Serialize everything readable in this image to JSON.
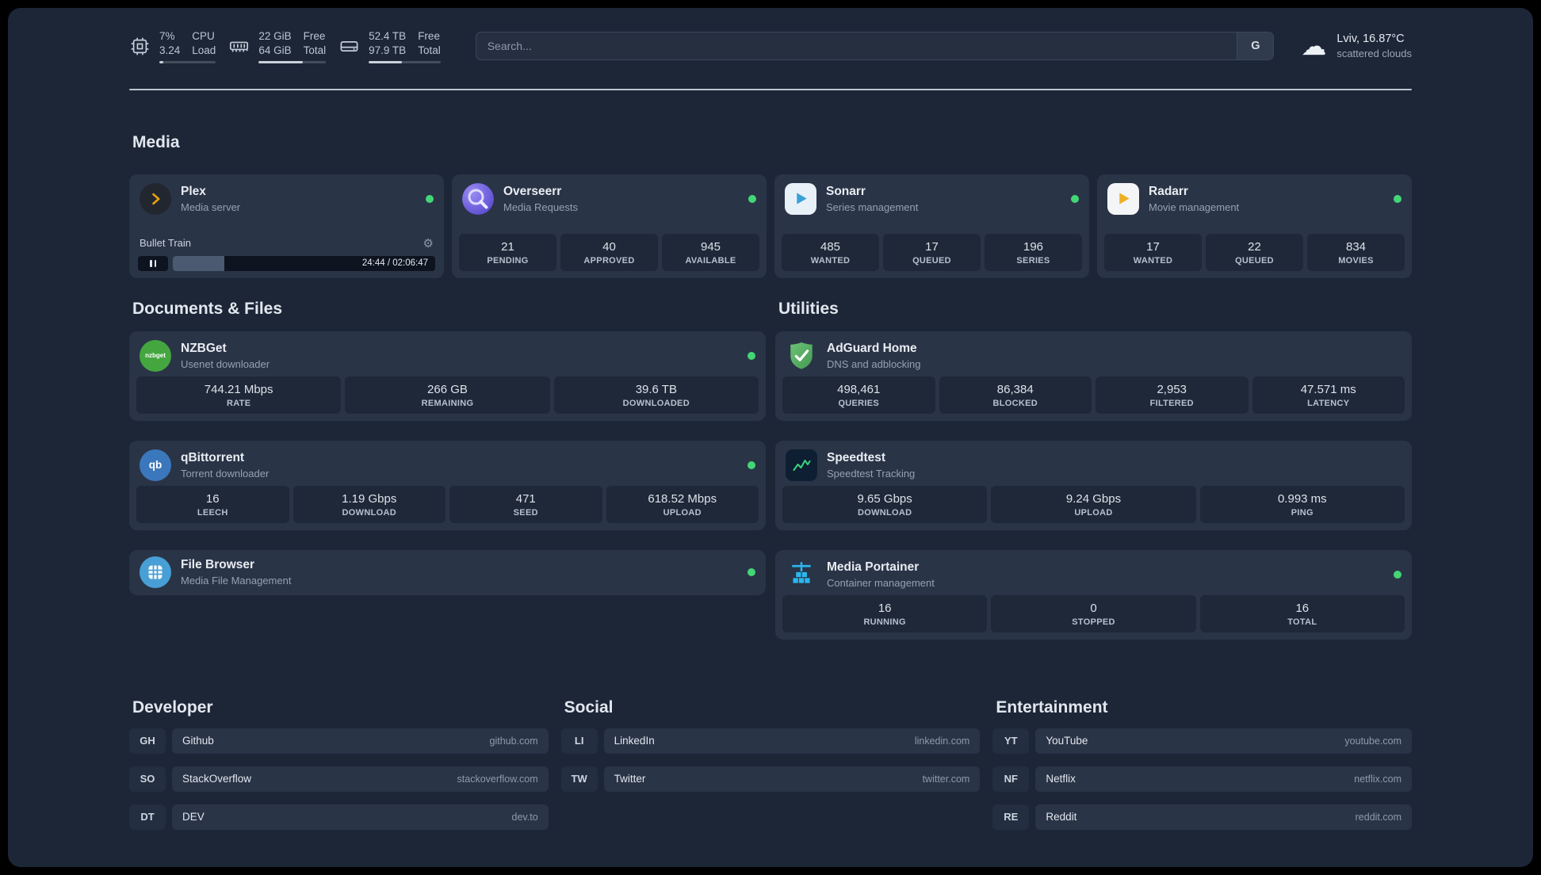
{
  "colors": {
    "status_online": "#43d675",
    "accent_plex": "#e5a00d",
    "accent_sonarr": "#3aa0d8",
    "accent_radarr": "#edb024",
    "accent_adguard": "#5fb363",
    "accent_speedtest": "#3bd47c",
    "accent_portainer": "#29b8f0"
  },
  "icons": {
    "gear": "⚙",
    "cloud": "☁"
  },
  "topbar": {
    "cpu": {
      "value_top": "7%",
      "value_bottom": "3.24",
      "label_top": "CPU",
      "label_bottom": "Load",
      "bar_percent": 7
    },
    "memory": {
      "value_top": "22 GiB",
      "value_bottom": "64 GiB",
      "label_top": "Free",
      "label_bottom": "Total",
      "bar_percent": 66
    },
    "disk": {
      "value_top": "52.4 TB",
      "value_bottom": "97.9 TB",
      "label_top": "Free",
      "label_bottom": "Total",
      "bar_percent": 46
    },
    "search": {
      "placeholder": "Search...",
      "provider_button": "G"
    },
    "weather": {
      "location": "Lviv, 16.87°C",
      "condition": "scattered clouds"
    }
  },
  "sections": {
    "media": {
      "title": "Media",
      "plex": {
        "name": "Plex",
        "desc": "Media server",
        "player": {
          "track": "Bullet Train",
          "time": "24:44 / 02:06:47",
          "progress_percent": 19.5
        }
      },
      "overseerr": {
        "name": "Overseerr",
        "desc": "Media Requests",
        "stats": [
          {
            "value": "21",
            "label": "PENDING"
          },
          {
            "value": "40",
            "label": "APPROVED"
          },
          {
            "value": "945",
            "label": "AVAILABLE"
          }
        ]
      },
      "sonarr": {
        "name": "Sonarr",
        "desc": "Series management",
        "stats": [
          {
            "value": "485",
            "label": "WANTED"
          },
          {
            "value": "17",
            "label": "QUEUED"
          },
          {
            "value": "196",
            "label": "SERIES"
          }
        ]
      },
      "radarr": {
        "name": "Radarr",
        "desc": "Movie management",
        "stats": [
          {
            "value": "17",
            "label": "WANTED"
          },
          {
            "value": "22",
            "label": "QUEUED"
          },
          {
            "value": "834",
            "label": "MOVIES"
          }
        ]
      }
    },
    "documents": {
      "title": "Documents & Files",
      "nzbget": {
        "name": "NZBGet",
        "desc": "Usenet downloader",
        "icon_text": "nzbget",
        "stats": [
          {
            "value": "744.21 Mbps",
            "label": "RATE"
          },
          {
            "value": "266 GB",
            "label": "REMAINING"
          },
          {
            "value": "39.6 TB",
            "label": "DOWNLOADED"
          }
        ]
      },
      "qbittorrent": {
        "name": "qBittorrent",
        "desc": "Torrent downloader",
        "icon_text": "qb",
        "stats": [
          {
            "value": "16",
            "label": "LEECH"
          },
          {
            "value": "1.19 Gbps",
            "label": "DOWNLOAD"
          },
          {
            "value": "471",
            "label": "SEED"
          },
          {
            "value": "618.52 Mbps",
            "label": "UPLOAD"
          }
        ]
      },
      "filebrowser": {
        "name": "File Browser",
        "desc": "Media File Management"
      }
    },
    "utilities": {
      "title": "Utilities",
      "adguard": {
        "name": "AdGuard Home",
        "desc": "DNS and adblocking",
        "stats": [
          {
            "value": "498,461",
            "label": "QUERIES"
          },
          {
            "value": "86,384",
            "label": "BLOCKED"
          },
          {
            "value": "2,953",
            "label": "FILTERED"
          },
          {
            "value": "47.571 ms",
            "label": "LATENCY"
          }
        ]
      },
      "speedtest": {
        "name": "Speedtest",
        "desc": "Speedtest Tracking",
        "stats": [
          {
            "value": "9.65 Gbps",
            "label": "DOWNLOAD"
          },
          {
            "value": "9.24 Gbps",
            "label": "UPLOAD"
          },
          {
            "value": "0.993 ms",
            "label": "PING"
          }
        ]
      },
      "portainer": {
        "name": "Media Portainer",
        "desc": "Container management",
        "stats": [
          {
            "value": "16",
            "label": "RUNNING"
          },
          {
            "value": "0",
            "label": "STOPPED"
          },
          {
            "value": "16",
            "label": "TOTAL"
          }
        ]
      }
    }
  },
  "bookmarks": {
    "developer": {
      "title": "Developer",
      "items": [
        {
          "abbr": "GH",
          "name": "Github",
          "url": "github.com"
        },
        {
          "abbr": "SO",
          "name": "StackOverflow",
          "url": "stackoverflow.com"
        },
        {
          "abbr": "DT",
          "name": "DEV",
          "url": "dev.to"
        }
      ]
    },
    "social": {
      "title": "Social",
      "items": [
        {
          "abbr": "LI",
          "name": "LinkedIn",
          "url": "linkedin.com"
        },
        {
          "abbr": "TW",
          "name": "Twitter",
          "url": "twitter.com"
        }
      ]
    },
    "entertainment": {
      "title": "Entertainment",
      "items": [
        {
          "abbr": "YT",
          "name": "YouTube",
          "url": "youtube.com"
        },
        {
          "abbr": "NF",
          "name": "Netflix",
          "url": "netflix.com"
        },
        {
          "abbr": "RE",
          "name": "Reddit",
          "url": "reddit.com"
        }
      ]
    }
  }
}
